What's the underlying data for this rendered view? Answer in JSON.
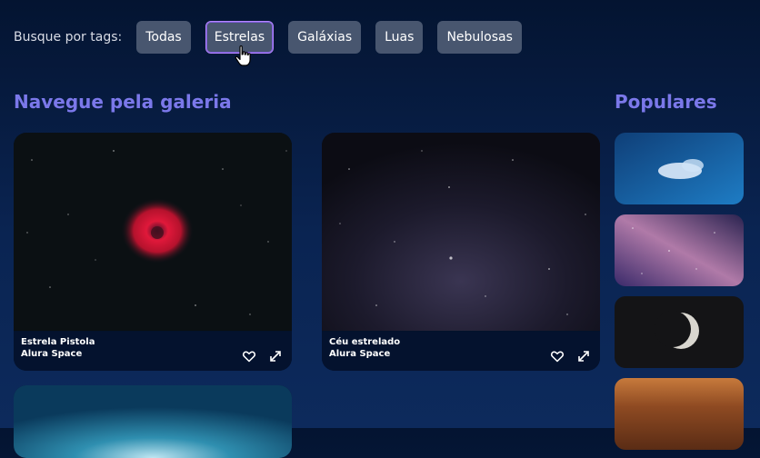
{
  "tags": {
    "label": "Busque por tags:",
    "items": [
      "Todas",
      "Estrelas",
      "Galáxias",
      "Luas",
      "Nebulosas"
    ],
    "active": "Estrelas"
  },
  "gallery": {
    "title": "Navegue pela galeria",
    "cards": [
      {
        "title": "Estrela Pistola",
        "author": "Alura Space"
      },
      {
        "title": "Céu estrelado",
        "author": "Alura Space"
      }
    ]
  },
  "popular": {
    "title": "Populares"
  },
  "icons": [
    "heart-icon",
    "expand-icon",
    "hand-cursor-icon"
  ]
}
